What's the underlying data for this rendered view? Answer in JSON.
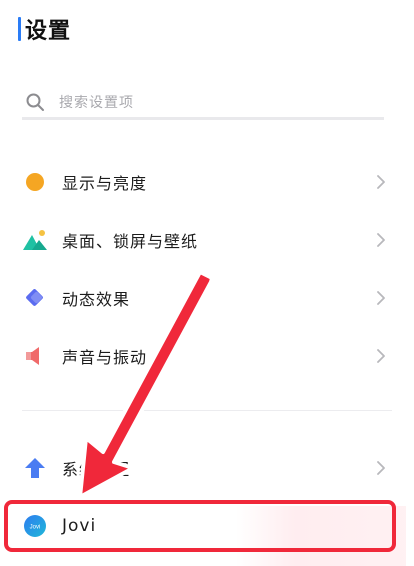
{
  "header": {
    "title": "设置"
  },
  "search": {
    "placeholder": "搜索设置项",
    "icon": "search-icon"
  },
  "settings": {
    "items": [
      {
        "label": "显示与亮度",
        "icon": "sun-icon",
        "color": "#f5a623"
      },
      {
        "label": "桌面、锁屏与壁纸",
        "icon": "landscape-icon",
        "color": "#1fc1a3"
      },
      {
        "label": "动态效果",
        "icon": "diamond-icon",
        "color": "#5b6cf0"
      },
      {
        "label": "声音与振动",
        "icon": "speaker-icon",
        "color": "#f06a6a"
      }
    ],
    "system_label": "系统管理",
    "jovi_label": "Jovi",
    "jovi_badge": "Jovi"
  },
  "colors": {
    "accent": "#2a7cf6",
    "annotation_red": "#f0283a"
  }
}
